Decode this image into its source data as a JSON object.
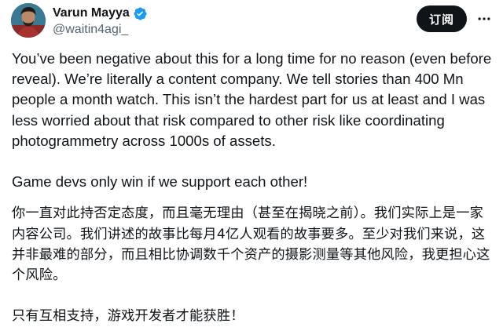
{
  "author": {
    "display_name": "Varun Mayya",
    "handle": "@waitin4agi_",
    "verified_icon": "verified-badge-icon",
    "colors": {
      "verified": "#1d9bf0",
      "handle": "#536471"
    }
  },
  "actions": {
    "subscribe_label": "订阅",
    "more_icon": "more-horizontal-icon"
  },
  "tweet": {
    "paragraphs": [
      "You’ve been negative about this for a long time for no reason (even before reveal). We’re literally a content company. We tell stories than 400 Mn people a month watch. This isn’t the hardest part for us at least and I was less worried about that risk compared to other risk like coordinating photogrammetry across 1000s of assets.",
      "Game devs only win if we support each other!",
      "你一直对此持否定态度，而且毫无理由（甚至在揭晓之前）。我们实际上是一家内容公司。我们讲述的故事比每月4亿人观看的故事要多。至少对我们来说，这并非最难的部分，而且相比协调数千个资产的摄影测量等其他风险，我更担心这个风险。",
      "只有互相支持，游戏开发者才能获胜！"
    ]
  }
}
